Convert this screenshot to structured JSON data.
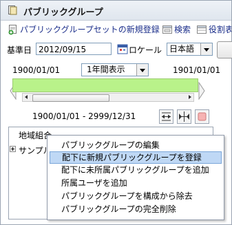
{
  "header": {
    "title": "パブリックグループ"
  },
  "toolbar": {
    "new_set": "パブリックグループセットの新規登録",
    "search": "検索",
    "role": "役割表"
  },
  "filters": {
    "base_date_label": "基準日",
    "base_date_value": "2012/09/15",
    "locale_label": "ロケール",
    "locale_value": "日本語"
  },
  "timeline": {
    "start": "1900/01/01",
    "end": "1901/01/01",
    "period_option": "1年間表示",
    "range": "1900/01/01 - 2999/12/31"
  },
  "tree": {
    "nodes": [
      "地域組合",
      "サンプル"
    ]
  },
  "context_menu": {
    "items": [
      "パブリックグループの編集",
      "配下に新規パブリックグループを登録",
      "配下に未所属パブリックグループを追加",
      "所属ユーザを追加",
      "パブリックグループを構成から除去",
      "パブリックグループの完全削除"
    ],
    "highlighted_index": 1
  },
  "colors": {
    "timeline_fill": "#b9f28a",
    "menu_highlight": "#bfd8f5",
    "toolbar_link": "#1b2e8a"
  }
}
